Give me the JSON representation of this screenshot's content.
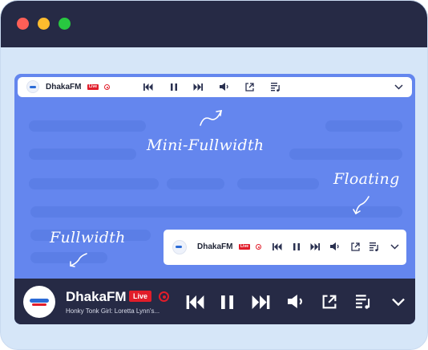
{
  "window": {
    "title": ""
  },
  "labels": {
    "mini": "Mini-Fullwidth",
    "floating": "Floating",
    "fullwidth": "Fullwidth"
  },
  "station": {
    "name": "DhakaFM",
    "live_badge": "Live",
    "track": "Honky Tonk Girl: Loretta Lynn's..."
  },
  "colors": {
    "brand_blue": "#6486ee",
    "dark_bar": "#262a45",
    "live_red": "#e11d2a"
  },
  "controls": [
    "skip-back-icon",
    "pause-icon",
    "skip-forward-icon",
    "volume-icon",
    "popout-icon",
    "playlist-icon",
    "chevron-down-icon"
  ]
}
